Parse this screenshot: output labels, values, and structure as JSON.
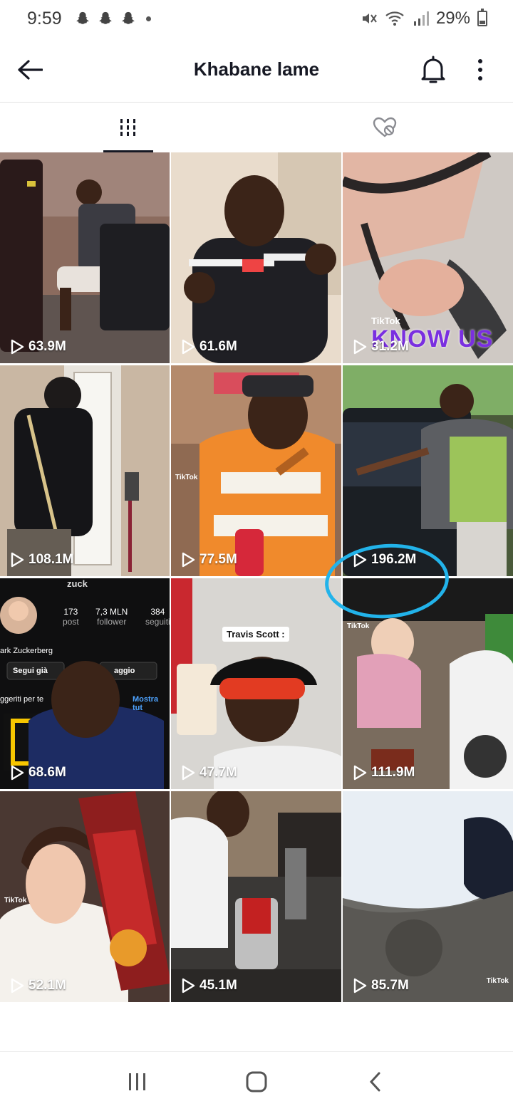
{
  "status_bar": {
    "time": "9:59",
    "battery": "29%",
    "battery_level": 0.29,
    "icons": [
      "snapchat-icon",
      "snapchat-icon",
      "snapchat-icon",
      "notification-dot",
      "mute-icon",
      "wifi-icon",
      "signal-icon",
      "battery-icon"
    ]
  },
  "header": {
    "title": "Khabane lame",
    "back_icon": "arrow-left-icon",
    "bell_icon": "bell-icon",
    "more_icon": "more-vertical-icon"
  },
  "tabs": [
    {
      "name": "videos",
      "icon": "grid-icon",
      "active": true
    },
    {
      "name": "liked",
      "icon": "heart-hidden-icon",
      "active": false
    }
  ],
  "videos": [
    {
      "views": "63.9M"
    },
    {
      "views": "61.6M"
    },
    {
      "views": "31.2M"
    },
    {
      "views": "108.1M"
    },
    {
      "views": "77.5M"
    },
    {
      "views": "196.2M"
    },
    {
      "views": "68.6M"
    },
    {
      "views": "47.7M"
    },
    {
      "views": "111.9M"
    },
    {
      "views": "52.1M"
    },
    {
      "views": "45.1M"
    },
    {
      "views": "85.7M"
    }
  ],
  "thumbnail_text": {
    "travis": "Travis Scott :",
    "tiktok": "TikTok",
    "know_us": "KNOW US",
    "profile_posts_num": "173",
    "profile_posts": "post",
    "profile_followers_num": "7,3 MLN",
    "profile_followers": "follower",
    "profile_following_num": "384",
    "profile_following": "seguiti",
    "profile_name": "ark Zuckerberg",
    "profile_follow": "Segui già",
    "profile_message": "aggio",
    "profile_suggested": "ggeriti per te",
    "profile_show_all": "Mostra tut",
    "profile_header": "zuck"
  },
  "annotation": {
    "color": "#22b3ea"
  },
  "nav_bar": {
    "icons": [
      "recent-apps-icon",
      "home-icon",
      "back-icon"
    ]
  }
}
